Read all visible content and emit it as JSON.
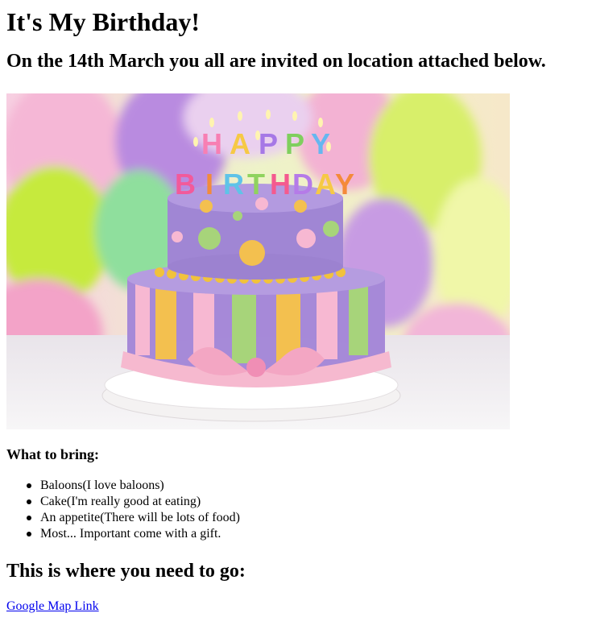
{
  "page": {
    "title": "It's My Birthday!",
    "invite": "On the 14th March you all are invited on location attached below."
  },
  "photo": {
    "candle_letters": [
      "H",
      "A",
      "P",
      "P",
      "Y",
      "B",
      "I",
      "R",
      "T",
      "H",
      "D",
      "A",
      "Y"
    ]
  },
  "bring": {
    "heading": "What to bring:",
    "items": [
      "Baloons(I love baloons)",
      "Cake(I'm really good at eating)",
      "An appetite(There will be lots of food)",
      "Most... Important come with a gift."
    ]
  },
  "location": {
    "heading": "This is where you need to go:",
    "link_label": "Google Map Link"
  },
  "colors": {
    "link": "#0000ee",
    "text": "#000000"
  }
}
